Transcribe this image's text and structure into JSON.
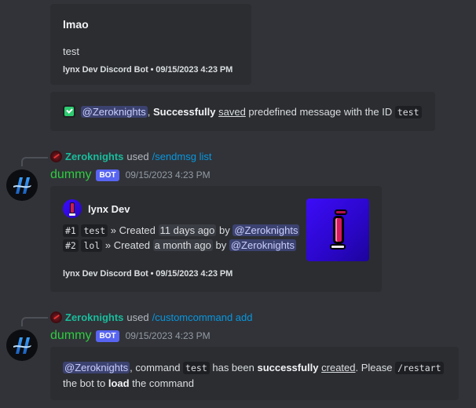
{
  "embed1": {
    "title": "lmao",
    "description": "test",
    "footer": "lynx Dev Discord Bot • 09/15/2023 4:23 PM"
  },
  "embed2": {
    "icon": "check-mark-icon",
    "mention": "@Zeroknights",
    "text_comma": ", ",
    "bold": "Successfully",
    "underlined": "saved",
    "text_mid": " predefined message with the ID ",
    "code": "test"
  },
  "message1": {
    "reply": {
      "user": "Zeroknights",
      "used": "used",
      "command": "/sendmsg list"
    },
    "username": "dummy",
    "bot_tag": "BOT",
    "timestamp": "09/15/2023 4:23 PM",
    "embed": {
      "author": "lynx Dev",
      "rows": [
        {
          "index": "#1",
          "name": "test",
          "created_label": " » Created ",
          "when": "11 days ago",
          "by": " by ",
          "mention": "@Zeroknights"
        },
        {
          "index": "#2",
          "name": "lol",
          "created_label": " » Created ",
          "when": "a month ago",
          "by": " by ",
          "mention": "@Zeroknights"
        }
      ],
      "footer": "lynx Dev Discord Bot • 09/15/2023 4:23 PM",
      "thumbnail": "lynx-logo-thumbnail"
    }
  },
  "message2": {
    "reply": {
      "user": "Zeroknights",
      "used": "used",
      "command": "/customcommand add"
    },
    "username": "dummy",
    "bot_tag": "BOT",
    "timestamp": "09/15/2023 4:23 PM",
    "embed": {
      "mention": "@Zeroknights",
      "t1": ", command ",
      "code1": "test",
      "t2": " has been ",
      "bold1": "successfully",
      "t3": " ",
      "underlined": "created",
      "t4": ". Please ",
      "code2": "/restart",
      "t5": "the bot to ",
      "bold2": "load",
      "t6": " the command"
    }
  },
  "colors": {
    "background": "#313338",
    "embed_bg": "#2b2d31",
    "mention_bg": "#3c4270",
    "bot_tag": "#5865f2",
    "username": "#2ecc40",
    "reply_user": "#1abc9c",
    "command_link": "#00a8fc"
  }
}
